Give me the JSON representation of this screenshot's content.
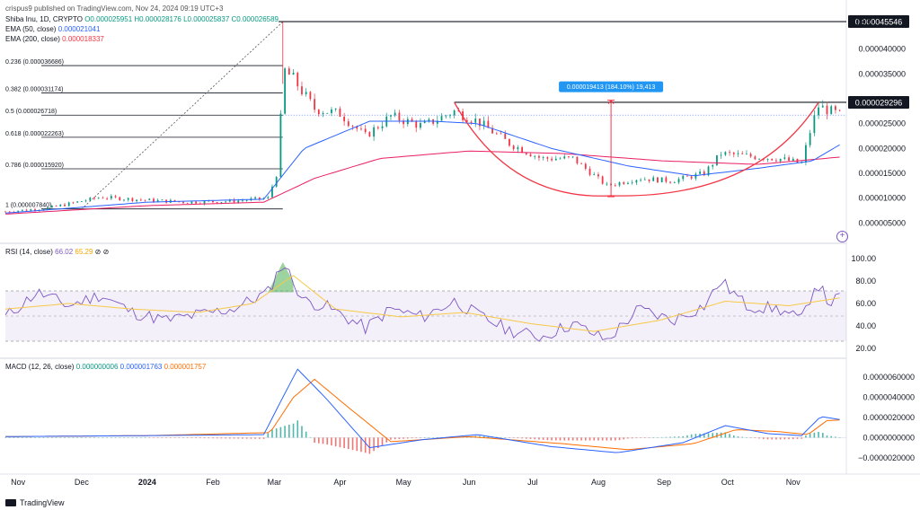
{
  "publisher": "crispus9 published on TradingView.com, Nov 24, 2024 09:19 UTC+3",
  "main_legend": {
    "symbol": "Shiba Inu, 1D, CRYPTO",
    "o": "O0.000025951",
    "h": "H0.000028176",
    "l": "L0.000025837",
    "c": "C0.000026589",
    "ema50_label": "EMA (50, close)",
    "ema50_value": "0.000021041",
    "ema200_label": "EMA (200, close)",
    "ema200_value": "0.000018337"
  },
  "currency": "USD",
  "price_axis": [
    "0.000040000",
    "0.000035000",
    "0.000025000",
    "0.000020000",
    "0.000015000",
    "0.000010000",
    "0.000005000"
  ],
  "price_tags": {
    "high": "0.000045546",
    "resistance": "0.000029296"
  },
  "fib_labels": [
    "0.236 (0.000036686)",
    "0.382 (0.000031174)",
    "0.5 (0.000026718)",
    "0.618 (0.000022263)",
    "0.786 (0.000015920)",
    "1 (0.000007840)"
  ],
  "measure_label": "0.000019413 (184.10%) 19,413",
  "rsi_legend": {
    "label": "RSI (14, close)",
    "rsi": "66.02",
    "ma": "65.29"
  },
  "rsi_axis": [
    "100.00",
    "80.00",
    "60.00",
    "40.00",
    "20.00"
  ],
  "macd_legend": {
    "label": "MACD (12, 26, close)",
    "hist": "0.000000006",
    "macd": "0.000001763",
    "signal": "0.000001757"
  },
  "macd_axis": [
    "0.0000060000",
    "0.0000040000",
    "0.0000020000",
    "0.0000000000",
    "−0.0000020000"
  ],
  "x_axis": [
    "Nov",
    "Dec",
    "2024",
    "Feb",
    "Mar",
    "Apr",
    "May",
    "Jun",
    "Jul",
    "Aug",
    "Sep",
    "Oct",
    "Nov"
  ],
  "brand": "TradingView",
  "colors": {
    "up": "#089981",
    "down": "#f23645",
    "ema50": "#2962ff",
    "ema200": "#e91e63",
    "rsi": "#7e57c2",
    "rsi_ma": "#f7c948",
    "macd": "#2962ff",
    "signal": "#ff6d00",
    "accent": "#2962ff"
  },
  "chart_data": [
    {
      "type": "candlestick",
      "title": "Shiba Inu, 1D, CRYPTO",
      "ylim": [
        2e-06,
        4.7e-05
      ],
      "price_path": {
        "dates": [
          "2023-10-26",
          "2023-11-15",
          "2023-12-10",
          "2024-01-01",
          "2024-01-20",
          "2024-02-10",
          "2024-02-27",
          "2024-03-03",
          "2024-03-05",
          "2024-03-10",
          "2024-03-20",
          "2024-04-01",
          "2024-04-13",
          "2024-04-25",
          "2024-05-10",
          "2024-05-25",
          "2024-06-05",
          "2024-06-20",
          "2024-07-05",
          "2024-07-20",
          "2024-08-05",
          "2024-08-20",
          "2024-09-05",
          "2024-09-20",
          "2024-09-28",
          "2024-10-10",
          "2024-10-25",
          "2024-11-05",
          "2024-11-10",
          "2024-11-13",
          "2024-11-24"
        ],
        "close": [
          7.3e-06,
          8e-06,
          1.02e-05,
          9.6e-06,
          9.2e-06,
          9.4e-06,
          1e-05,
          1.6e-05,
          3.6e-05,
          3.4e-05,
          2.8e-05,
          2.7e-05,
          2.25e-05,
          2.65e-05,
          2.45e-05,
          2.75e-05,
          2.55e-05,
          2.1e-05,
          1.8e-05,
          1.8e-05,
          1.25e-05,
          1.4e-05,
          1.35e-05,
          1.5e-05,
          1.9e-05,
          1.85e-05,
          1.8e-05,
          1.7e-05,
          2.5e-05,
          2.85e-05,
          2.66e-05
        ]
      },
      "ema50": {
        "dates": [
          "2023-10-26",
          "2024-01-01",
          "2024-02-25",
          "2024-03-15",
          "2024-04-15",
          "2024-05-15",
          "2024-06-05",
          "2024-07-10",
          "2024-08-15",
          "2024-09-15",
          "2024-10-15",
          "2024-11-10",
          "2024-11-24"
        ],
        "values": [
          7e-06,
          9.2e-06,
          9.8e-06,
          2e-05,
          2.55e-05,
          2.55e-05,
          2.5e-05,
          2e-05,
          1.65e-05,
          1.45e-05,
          1.6e-05,
          1.75e-05,
          2.1e-05
        ]
      },
      "ema200": {
        "dates": [
          "2023-10-26",
          "2024-01-01",
          "2024-02-25",
          "2024-03-20",
          "2024-04-20",
          "2024-06-01",
          "2024-07-15",
          "2024-09-01",
          "2024-10-15",
          "2024-11-24"
        ],
        "values": [
          6.8e-06,
          8.5e-06,
          9.2e-06,
          1.4e-05,
          1.8e-05,
          1.95e-05,
          1.9e-05,
          1.75e-05,
          1.68e-05,
          1.83e-05
        ]
      },
      "fibonacci": [
        {
          "level": "0.236",
          "price": 3.6686e-05
        },
        {
          "level": "0.382",
          "price": 3.1174e-05
        },
        {
          "level": "0.5",
          "price": 2.6718e-05
        },
        {
          "level": "0.618",
          "price": 2.2263e-05
        },
        {
          "level": "0.786",
          "price": 1.592e-05
        },
        {
          "level": "1",
          "price": 7.84e-06
        }
      ],
      "horizontal_lines": [
        4.5546e-05,
        2.9296e-05
      ],
      "cup_pattern": {
        "left": [
          "2024-05-25",
          2.9296e-05
        ],
        "bottom": [
          "2024-08-07",
          1.05e-05
        ],
        "right": [
          "2024-11-13",
          2.9296e-05
        ]
      },
      "measure": {
        "date": "2024-08-07",
        "from": 1.03e-05,
        "to": 2.9713e-05
      }
    },
    {
      "type": "line",
      "title": "RSI (14, close)",
      "ylim": [
        15,
        105
      ],
      "band": [
        30,
        70
      ],
      "rsi": {
        "dates": [
          "2023-10-26",
          "2023-11-10",
          "2023-11-25",
          "2023-12-10",
          "2023-12-25",
          "2024-01-10",
          "2024-01-25",
          "2024-02-10",
          "2024-02-27",
          "2024-03-05",
          "2024-03-15",
          "2024-03-25",
          "2024-04-13",
          "2024-04-25",
          "2024-05-10",
          "2024-05-25",
          "2024-06-05",
          "2024-06-20",
          "2024-07-05",
          "2024-07-20",
          "2024-08-05",
          "2024-08-20",
          "2024-09-05",
          "2024-09-20",
          "2024-09-28",
          "2024-10-10",
          "2024-10-25",
          "2024-11-05",
          "2024-11-12",
          "2024-11-18",
          "2024-11-24"
        ],
        "values": [
          48,
          70,
          58,
          68,
          52,
          45,
          50,
          55,
          70,
          97,
          62,
          58,
          38,
          55,
          48,
          62,
          50,
          36,
          30,
          42,
          27,
          55,
          45,
          58,
          80,
          58,
          55,
          45,
          80,
          60,
          66.02
        ]
      },
      "rsi_ma": {
        "dates": [
          "2023-10-26",
          "2023-11-25",
          "2023-12-25",
          "2024-01-25",
          "2024-02-20",
          "2024-03-10",
          "2024-03-30",
          "2024-04-30",
          "2024-05-30",
          "2024-06-30",
          "2024-07-30",
          "2024-08-30",
          "2024-09-30",
          "2024-10-30",
          "2024-11-24"
        ],
        "values": [
          55,
          60,
          55,
          52,
          60,
          85,
          55,
          48,
          52,
          42,
          35,
          45,
          62,
          58,
          65.29
        ]
      }
    },
    {
      "type": "line",
      "title": "MACD (12, 26, close)",
      "ylim": [
        -3e-06,
        7e-06
      ],
      "macd": {
        "dates": [
          "2023-10-26",
          "2024-01-01",
          "2024-02-25",
          "2024-03-05",
          "2024-03-12",
          "2024-03-25",
          "2024-04-15",
          "2024-05-10",
          "2024-06-05",
          "2024-07-10",
          "2024-08-10",
          "2024-09-10",
          "2024-09-30",
          "2024-10-20",
          "2024-11-05",
          "2024-11-14",
          "2024-11-24"
        ],
        "values": [
          1e-07,
          2e-07,
          3e-07,
          4e-06,
          6.8e-06,
          4e-06,
          -1e-06,
          -2e-07,
          3e-07,
          -9e-07,
          -1.5e-06,
          -5e-07,
          1.2e-06,
          4e-07,
          2e-07,
          2.1e-06,
          1.763e-06
        ]
      },
      "signal": {
        "dates": [
          "2023-10-26",
          "2024-01-01",
          "2024-02-28",
          "2024-03-10",
          "2024-03-20",
          "2024-04-05",
          "2024-04-25",
          "2024-06-01",
          "2024-07-15",
          "2024-08-15",
          "2024-09-15",
          "2024-10-05",
          "2024-10-25",
          "2024-11-08",
          "2024-11-17",
          "2024-11-24"
        ],
        "values": [
          1e-07,
          2e-07,
          5e-07,
          4e-06,
          5.8e-06,
          3e-06,
          -4e-07,
          1e-07,
          -6e-07,
          -1.2e-06,
          -6e-07,
          8e-07,
          6e-07,
          3e-07,
          1.7e-06,
          1.757e-06
        ]
      }
    }
  ]
}
